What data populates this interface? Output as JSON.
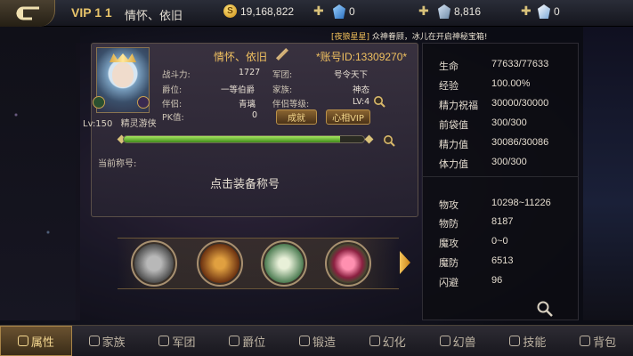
{
  "header": {
    "vip": "VIP 1 1",
    "player_name": "情怀、依旧",
    "gold": "19,168,822",
    "gem_blue": "0",
    "gem_silver": "8,816",
    "gem_white": "0"
  },
  "ticker": {
    "tag": "[夜狼星星]",
    "message": "众神眷顾，冰儿在开启神秘宝箱!"
  },
  "profile": {
    "name": "情怀、依旧",
    "account": "*账号ID:13309270*",
    "level_line": "Lv:150",
    "class_name": "精灵游侠",
    "combat_label": "战斗力:",
    "combat_value": "1727",
    "rank_label": "爵位:",
    "rank_value": "一等伯爵",
    "partner_label": "伴侣:",
    "partner_value": "青璃",
    "pk_label": "PK值:",
    "pk_value": "0",
    "army_label": "军团:",
    "army_value": "号令天下",
    "family_label": "家族:",
    "family_value": "神态",
    "partner_level_label": "伴侣等级:",
    "partner_level_value": "LV:4",
    "achieve_button": "成就",
    "vip_button": "心相VIP",
    "exp_fill": 0.9,
    "current_title_label": "当前称号:",
    "equip_title": "点击装备称号"
  },
  "slots": [
    {
      "icon": "heart-stone-icon",
      "color": "#8a8a8a"
    },
    {
      "icon": "golden-horse-icon",
      "color": "#9a5a20"
    },
    {
      "icon": "goddess-icon",
      "color": "#6aa070"
    },
    {
      "icon": "rose-icon",
      "color": "#c04070"
    }
  ],
  "attributes": [
    {
      "label": "生命",
      "value": "77633/77633"
    },
    {
      "label": "经验",
      "value": "100.00%"
    },
    {
      "label": "精力祝福",
      "value": "30000/30000"
    },
    {
      "label": "前袋值",
      "value": "300/300"
    },
    {
      "label": "精力值",
      "value": "30086/30086"
    },
    {
      "label": "体力值",
      "value": "300/300"
    }
  ],
  "combat_stats": [
    {
      "label": "物攻",
      "value": "10298~11226"
    },
    {
      "label": "物防",
      "value": "8187"
    },
    {
      "label": "魔攻",
      "value": "0~0"
    },
    {
      "label": "魔防",
      "value": "6513"
    },
    {
      "label": "闪避",
      "value": "96"
    }
  ],
  "tabs": [
    {
      "label": "属性",
      "icon": "medal-icon",
      "active": true
    },
    {
      "label": "家族",
      "icon": "shield-icon"
    },
    {
      "label": "军团",
      "icon": "wings-icon"
    },
    {
      "label": "爵位",
      "icon": "crown-icon"
    },
    {
      "label": "锻造",
      "icon": "hammer-icon"
    },
    {
      "label": "幻化",
      "icon": "swirl-icon"
    },
    {
      "label": "幻兽",
      "icon": "beast-icon"
    },
    {
      "label": "技能",
      "icon": "skill-icon"
    },
    {
      "label": "背包",
      "icon": "bag-icon"
    }
  ]
}
